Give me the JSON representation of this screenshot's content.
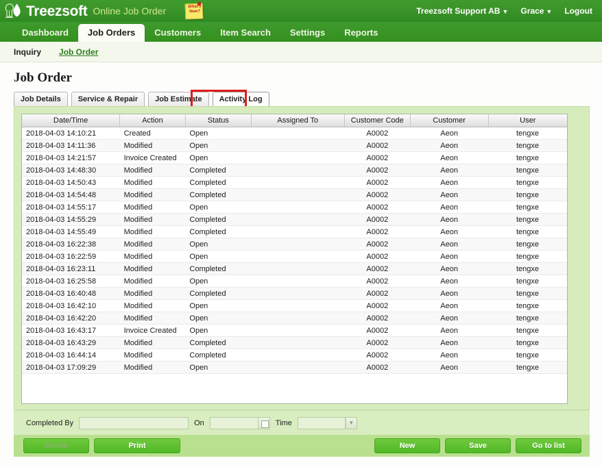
{
  "header": {
    "brand_name": "Treezsoft",
    "brand_tagline": "Online Job Order",
    "whats_new_line1": "What's",
    "whats_new_line2": "New?",
    "company": "Treezsoft Support AB",
    "user": "Grace",
    "logout": "Logout",
    "caret": "▼"
  },
  "mainnav": [
    {
      "label": "Dashboard",
      "active": false
    },
    {
      "label": "Job Orders",
      "active": true
    },
    {
      "label": "Customers",
      "active": false
    },
    {
      "label": "Item Search",
      "active": false
    },
    {
      "label": "Settings",
      "active": false
    },
    {
      "label": "Reports",
      "active": false
    }
  ],
  "subnav": [
    {
      "label": "Inquiry",
      "active": false
    },
    {
      "label": "Job Order",
      "active": true
    }
  ],
  "page": {
    "title": "Job Order"
  },
  "subtabs": [
    {
      "label": "Job Details",
      "active": false
    },
    {
      "label": "Service & Repair",
      "active": false
    },
    {
      "label": "Job Estimate",
      "active": false
    },
    {
      "label": "Activity Log",
      "active": true
    }
  ],
  "table": {
    "columns": [
      "Date/Time",
      "Action",
      "Status",
      "Assigned To",
      "Customer Code",
      "Customer",
      "User"
    ],
    "rows": [
      {
        "datetime": "2018-04-03 14:10:21",
        "action": "Created",
        "status": "Open",
        "assigned_to": "",
        "customer_code": "A0002",
        "customer": "Aeon",
        "user": "tengxe"
      },
      {
        "datetime": "2018-04-03 14:11:36",
        "action": "Modified",
        "status": "Open",
        "assigned_to": "",
        "customer_code": "A0002",
        "customer": "Aeon",
        "user": "tengxe"
      },
      {
        "datetime": "2018-04-03 14:21:57",
        "action": "Invoice Created",
        "status": "Open",
        "assigned_to": "",
        "customer_code": "A0002",
        "customer": "Aeon",
        "user": "tengxe"
      },
      {
        "datetime": "2018-04-03 14:48:30",
        "action": "Modified",
        "status": "Completed",
        "assigned_to": "",
        "customer_code": "A0002",
        "customer": "Aeon",
        "user": "tengxe"
      },
      {
        "datetime": "2018-04-03 14:50:43",
        "action": "Modified",
        "status": "Completed",
        "assigned_to": "",
        "customer_code": "A0002",
        "customer": "Aeon",
        "user": "tengxe"
      },
      {
        "datetime": "2018-04-03 14:54:48",
        "action": "Modified",
        "status": "Completed",
        "assigned_to": "",
        "customer_code": "A0002",
        "customer": "Aeon",
        "user": "tengxe"
      },
      {
        "datetime": "2018-04-03 14:55:17",
        "action": "Modified",
        "status": "Open",
        "assigned_to": "",
        "customer_code": "A0002",
        "customer": "Aeon",
        "user": "tengxe"
      },
      {
        "datetime": "2018-04-03 14:55:29",
        "action": "Modified",
        "status": "Completed",
        "assigned_to": "",
        "customer_code": "A0002",
        "customer": "Aeon",
        "user": "tengxe"
      },
      {
        "datetime": "2018-04-03 14:55:49",
        "action": "Modified",
        "status": "Completed",
        "assigned_to": "",
        "customer_code": "A0002",
        "customer": "Aeon",
        "user": "tengxe"
      },
      {
        "datetime": "2018-04-03 16:22:38",
        "action": "Modified",
        "status": "Open",
        "assigned_to": "",
        "customer_code": "A0002",
        "customer": "Aeon",
        "user": "tengxe"
      },
      {
        "datetime": "2018-04-03 16:22:59",
        "action": "Modified",
        "status": "Open",
        "assigned_to": "",
        "customer_code": "A0002",
        "customer": "Aeon",
        "user": "tengxe"
      },
      {
        "datetime": "2018-04-03 16:23:11",
        "action": "Modified",
        "status": "Completed",
        "assigned_to": "",
        "customer_code": "A0002",
        "customer": "Aeon",
        "user": "tengxe"
      },
      {
        "datetime": "2018-04-03 16:25:58",
        "action": "Modified",
        "status": "Open",
        "assigned_to": "",
        "customer_code": "A0002",
        "customer": "Aeon",
        "user": "tengxe"
      },
      {
        "datetime": "2018-04-03 16:40:48",
        "action": "Modified",
        "status": "Completed",
        "assigned_to": "",
        "customer_code": "A0002",
        "customer": "Aeon",
        "user": "tengxe"
      },
      {
        "datetime": "2018-04-03 16:42:10",
        "action": "Modified",
        "status": "Open",
        "assigned_to": "",
        "customer_code": "A0002",
        "customer": "Aeon",
        "user": "tengxe"
      },
      {
        "datetime": "2018-04-03 16:42:20",
        "action": "Modified",
        "status": "Open",
        "assigned_to": "",
        "customer_code": "A0002",
        "customer": "Aeon",
        "user": "tengxe"
      },
      {
        "datetime": "2018-04-03 16:43:17",
        "action": "Invoice Created",
        "status": "Open",
        "assigned_to": "",
        "customer_code": "A0002",
        "customer": "Aeon",
        "user": "tengxe"
      },
      {
        "datetime": "2018-04-03 16:43:29",
        "action": "Modified",
        "status": "Completed",
        "assigned_to": "",
        "customer_code": "A0002",
        "customer": "Aeon",
        "user": "tengxe"
      },
      {
        "datetime": "2018-04-03 16:44:14",
        "action": "Modified",
        "status": "Completed",
        "assigned_to": "",
        "customer_code": "A0002",
        "customer": "Aeon",
        "user": "tengxe"
      },
      {
        "datetime": "2018-04-03 17:09:29",
        "action": "Modified",
        "status": "Open",
        "assigned_to": "",
        "customer_code": "A0002",
        "customer": "Aeon",
        "user": "tengxe"
      }
    ]
  },
  "completed_bar": {
    "completed_by_label": "Completed By",
    "completed_by_value": "",
    "on_label": "On",
    "on_value": "",
    "time_label": "Time",
    "time_value": "",
    "time_caret": "▼"
  },
  "buttons": {
    "delete": "Delete",
    "print": "Print",
    "new": "New",
    "save": "Save",
    "go_to_list": "Go to list"
  },
  "colors": {
    "header_green": "#3a9328",
    "panel_green": "#d6ecbc",
    "button_green": "#52b828",
    "highlight_red": "#e01b1b",
    "link_green": "#2b7d1c"
  }
}
